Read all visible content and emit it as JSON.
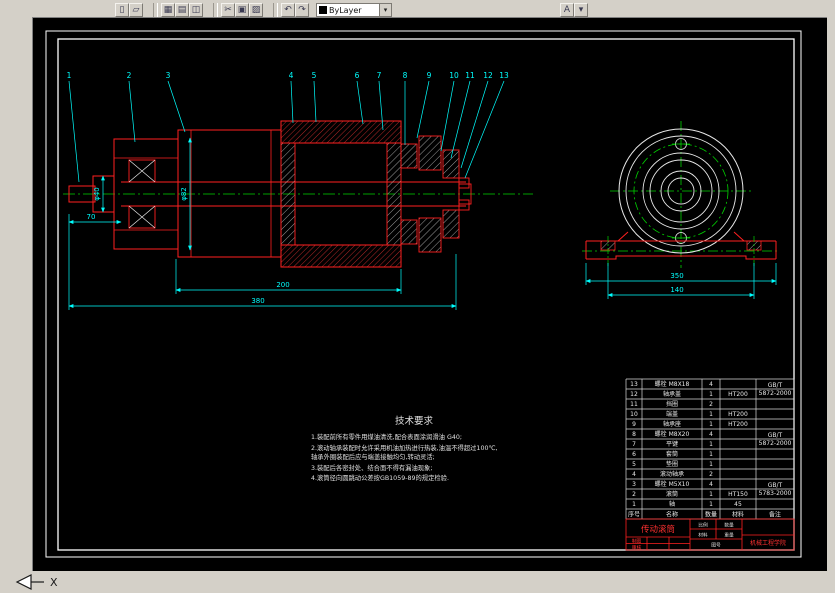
{
  "window": {
    "toolbar": {
      "buttons": [
        {
          "name": "new-icon",
          "glyph": "▯"
        },
        {
          "name": "open-icon",
          "glyph": "▱"
        },
        {
          "name": "save-icon",
          "glyph": "▦"
        },
        {
          "name": "print-icon",
          "glyph": "▤"
        },
        {
          "name": "preview-icon",
          "glyph": "◫"
        },
        {
          "name": "cut-icon",
          "glyph": "✂"
        },
        {
          "name": "copy-icon",
          "glyph": "▣"
        },
        {
          "name": "paste-icon",
          "glyph": "▨"
        },
        {
          "name": "undo-icon",
          "glyph": "↶"
        },
        {
          "name": "redo-icon",
          "glyph": "↷"
        }
      ],
      "layer_combo_value": "ByLayer",
      "text_style_button": "A",
      "dropdown_arrow": "▾"
    },
    "ucs_axis_label": "X"
  },
  "drawing": {
    "callouts": [
      "1",
      "2",
      "3",
      "4",
      "5",
      "6",
      "7",
      "8",
      "9",
      "10",
      "11",
      "12",
      "13"
    ],
    "dimensions": {
      "overall_length": "380",
      "roller_length": "200",
      "shaft_length": "70",
      "shaft_dia": "φ40",
      "body_dia": "φ82",
      "base_width": "350",
      "bolt_spacing": "140"
    },
    "tech_requirements": {
      "title": "技术要求",
      "lines": [
        "1.装配前所有零件用煤油清洗,配合表面涂润滑油 G40;",
        "2.滚动轴承装配时允许采用机油加热进行热装,油温不得超过100℃,",
        "   轴承外圈装配后应与端盖接触均匀,转动灵活;",
        "3.装配后各密封处、结合面不得有漏油现象;",
        "4.滚筒径向圆跳动公差按GB1059-89的规定检验."
      ]
    },
    "parts_list": {
      "headers": [
        "序号",
        "名称",
        "数量",
        "材料",
        "备注"
      ],
      "rows": [
        {
          "no": "13",
          "name": "螺栓 M8X18",
          "qty": "4",
          "mat": "",
          "rk1": "GB/T",
          "rk2": "5872-2000"
        },
        {
          "no": "12",
          "name": "轴承盖",
          "qty": "1",
          "mat": "HT200"
        },
        {
          "no": "11",
          "name": "挡圈",
          "qty": "2",
          "mat": ""
        },
        {
          "no": "10",
          "name": "端盖",
          "qty": "1",
          "mat": "HT200"
        },
        {
          "no": "9",
          "name": "轴承座",
          "qty": "1",
          "mat": "HT200"
        },
        {
          "no": "8",
          "name": "螺栓 M8X20",
          "qty": "4",
          "mat": "",
          "rk1": "GB/T",
          "rk2": "5872-2000"
        },
        {
          "no": "7",
          "name": "平键",
          "qty": "1",
          "mat": ""
        },
        {
          "no": "6",
          "name": "套筒",
          "qty": "1",
          "mat": ""
        },
        {
          "no": "5",
          "name": "垫圈",
          "qty": "1",
          "mat": ""
        },
        {
          "no": "4",
          "name": "滚动轴承",
          "qty": "2",
          "mat": ""
        },
        {
          "no": "3",
          "name": "螺栓 M5X10",
          "qty": "4",
          "mat": "",
          "rk1": "GB/T",
          "rk2": "5783-2000"
        },
        {
          "no": "2",
          "name": "滚筒",
          "qty": "1",
          "mat": "HT150"
        },
        {
          "no": "1",
          "name": "轴",
          "qty": "1",
          "mat": "45"
        }
      ]
    },
    "title_block": {
      "part_name": "传动滚筒",
      "drafter_label": "制图",
      "checker_label": "审核",
      "scale_label": "比例",
      "qty_label": "数量",
      "material_label": "材料",
      "weight_label": "重量",
      "drawing_no_label": "图号",
      "org": "机械工程学院"
    }
  }
}
